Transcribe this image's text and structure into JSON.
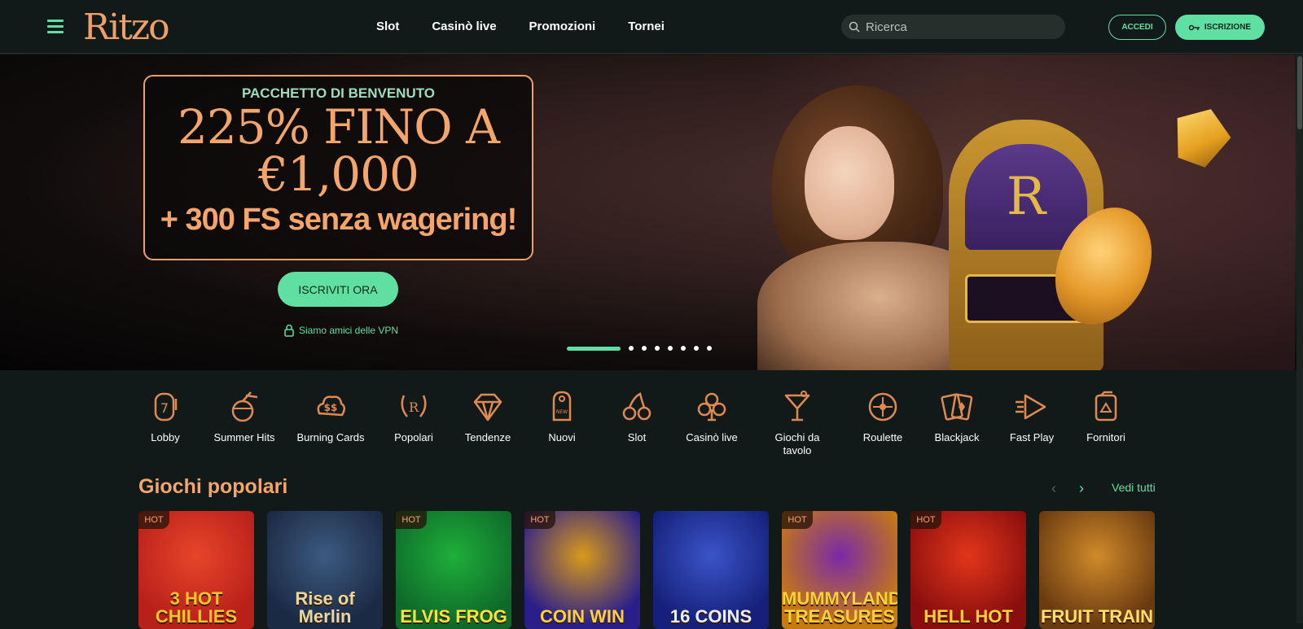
{
  "header": {
    "logo": "Ritzo",
    "nav": [
      "Slot",
      "Casinò live",
      "Promozioni",
      "Tornei"
    ],
    "search_placeholder": "Ricerca",
    "login_label": "ACCEDI",
    "signup_label": "ISCRIZIONE"
  },
  "hero": {
    "kicker": "PACCHETTO DI BENVENUTO",
    "main_line1": "225% FINO A",
    "main_line2": "€1,000",
    "sub": "+ 300 FS senza wagering!",
    "cta": "ISCRIVITI ORA",
    "vpn_text": "Siamo amici delle VPN",
    "slide_count": 8,
    "active_slide": 1
  },
  "categories": [
    {
      "label": "Lobby",
      "icon": "slot-seven-icon"
    },
    {
      "label": "Summer Hits",
      "icon": "coconut-drink-icon"
    },
    {
      "label": "Burning Cards",
      "icon": "dollar-cloud-icon"
    },
    {
      "label": "Popolari",
      "icon": "laurel-r-icon"
    },
    {
      "label": "Tendenze",
      "icon": "diamond-icon"
    },
    {
      "label": "Nuovi",
      "icon": "new-tag-icon"
    },
    {
      "label": "Slot",
      "icon": "cherries-icon"
    },
    {
      "label": "Casinò live",
      "icon": "club-icon"
    },
    {
      "label": "Giochi da tavolo",
      "icon": "cocktail-icon"
    },
    {
      "label": "Roulette",
      "icon": "roulette-icon"
    },
    {
      "label": "Blackjack",
      "icon": "cards-icon"
    },
    {
      "label": "Fast Play",
      "icon": "fast-play-icon"
    },
    {
      "label": "Fornitori",
      "icon": "provider-icon"
    }
  ],
  "section": {
    "title": "Giochi popolari",
    "see_all": "Vedi tutti",
    "prev_arrow": "‹",
    "next_arrow": "›"
  },
  "games": [
    {
      "title": "3 HOT CHILLIES",
      "hot": "HOT",
      "bg": "#b8201a",
      "bg2": "#e8452a",
      "fg": "#f2c230"
    },
    {
      "title": "Rise of Merlin",
      "hot": "",
      "bg": "#1b2a44",
      "bg2": "#3c5a80",
      "fg": "#e8d7a0"
    },
    {
      "title": "ELVIS FROG",
      "hot": "HOT",
      "bg": "#0e6a2a",
      "bg2": "#1fae3a",
      "fg": "#f7e43a"
    },
    {
      "title": "COIN WIN",
      "hot": "HOT",
      "bg": "#2a1e8a",
      "bg2": "#d89a1a",
      "fg": "#fbd23a"
    },
    {
      "title": "16 COINS",
      "hot": "",
      "bg": "#16207a",
      "bg2": "#3a54c8",
      "fg": "#e8eefc"
    },
    {
      "title": "MUMMYLAND TREASURES",
      "hot": "HOT",
      "bg": "#c77a10",
      "bg2": "#7a2aa8",
      "fg": "#f8d23a"
    },
    {
      "title": "HELL HOT",
      "hot": "HOT",
      "bg": "#8a0e0e",
      "bg2": "#e2361a",
      "fg": "#ffcf3a"
    },
    {
      "title": "FRUIT TRAIN",
      "hot": "",
      "bg": "#6a3a10",
      "bg2": "#d08a2a",
      "fg": "#ffdf6a"
    }
  ],
  "colors": {
    "accent": "#5fe0a2",
    "brand": "#f3a56c",
    "bg": "#111a19"
  }
}
